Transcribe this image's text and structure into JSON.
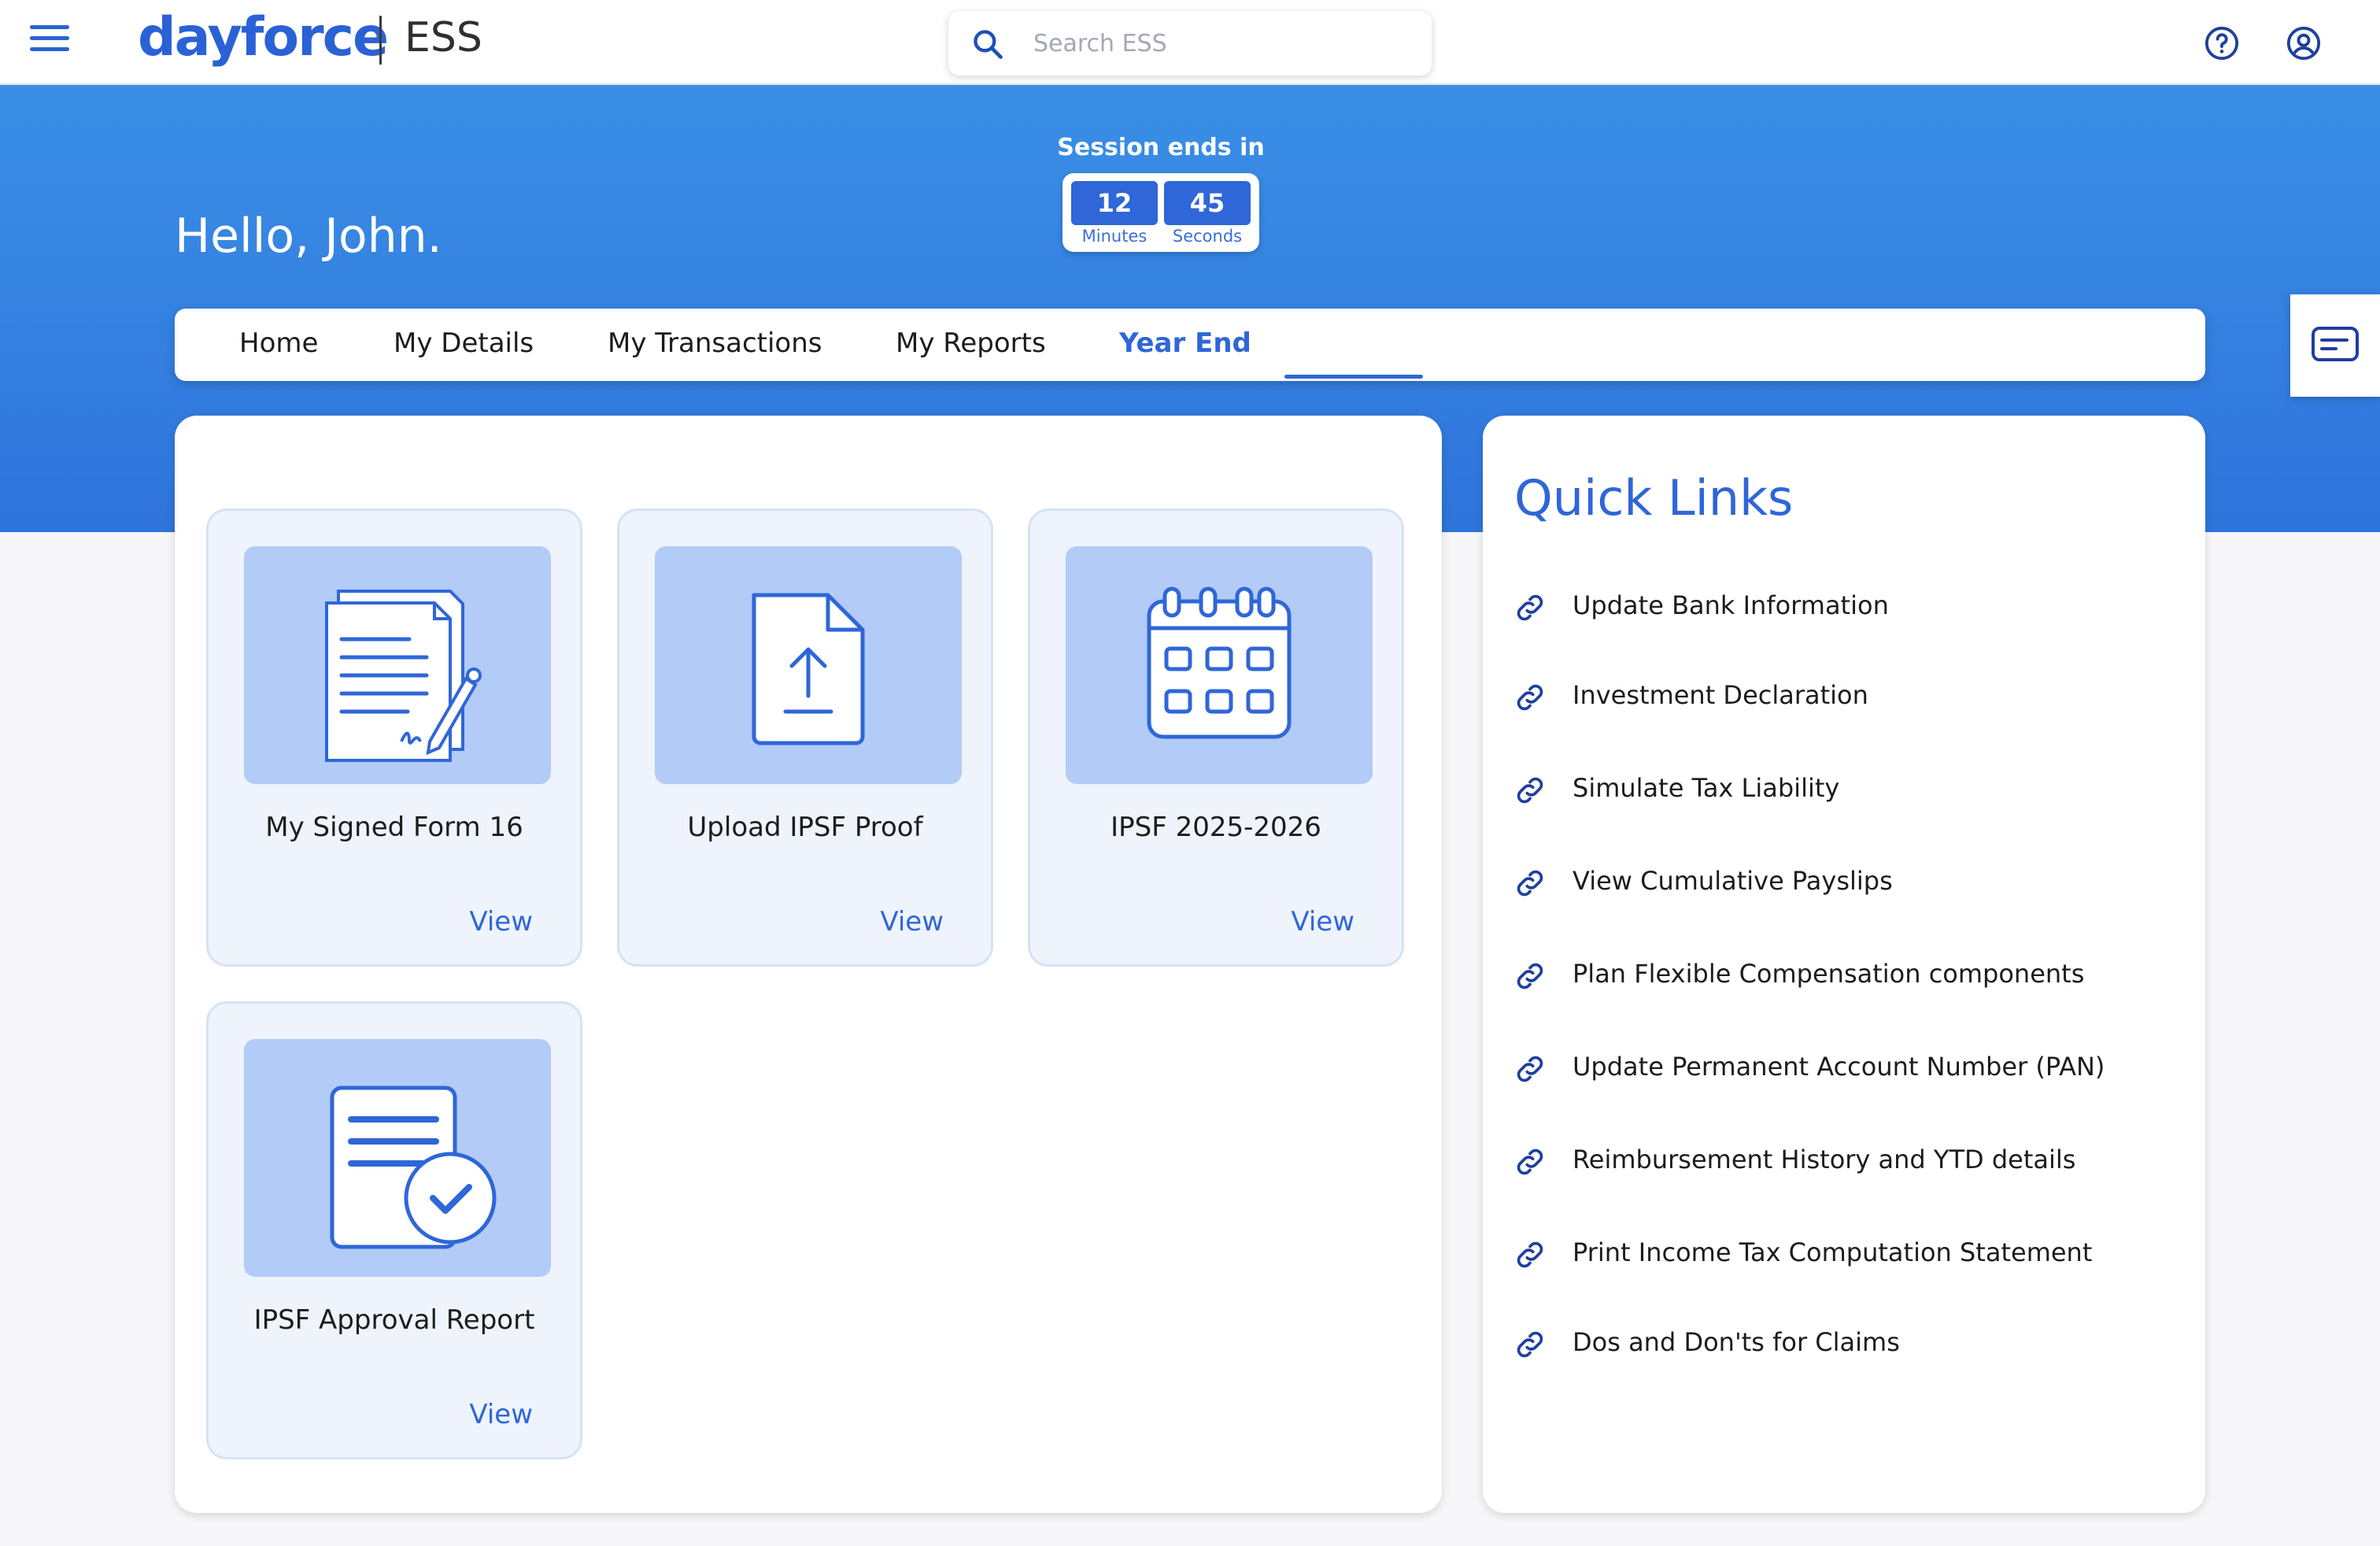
{
  "header": {
    "logo": "dayforce",
    "app_name": "ESS",
    "search_placeholder": "Search ESS"
  },
  "hero": {
    "greeting": "Hello, John.",
    "session_label": "Session ends in",
    "minutes_value": "12",
    "minutes_label": "Minutes",
    "seconds_value": "45",
    "seconds_label": "Seconds"
  },
  "tabs": [
    {
      "label": "Home"
    },
    {
      "label": "My Details"
    },
    {
      "label": "My Transactions"
    },
    {
      "label": "My Reports"
    },
    {
      "label": "Year End",
      "active": true
    }
  ],
  "cards": [
    {
      "title": "My Signed Form 16",
      "action": "View",
      "icon": "signed-document-icon"
    },
    {
      "title": "Upload IPSF Proof",
      "action": "View",
      "icon": "upload-file-icon"
    },
    {
      "title": "IPSF 2025-2026",
      "action": "View",
      "icon": "calendar-icon"
    },
    {
      "title": "IPSF Approval Report",
      "action": "View",
      "icon": "approved-document-icon"
    }
  ],
  "quick_links": {
    "title": "Quick Links",
    "items": [
      "Update Bank Information",
      "Investment Declaration",
      "Simulate Tax Liability",
      "View Cumulative Payslips",
      "Plan Flexible Compensation components",
      "Update Permanent Account Number (PAN)",
      "Reimbursement History and YTD details",
      "Print Income Tax Computation Statement",
      "Dos and Don'ts for Claims"
    ]
  },
  "colors": {
    "accent": "#2f66d8",
    "hero_top": "#3a8fe6",
    "hero_bottom": "#2f74dc",
    "card_bg": "#eef3fc",
    "thumb_bg": "#b2cbf7"
  }
}
